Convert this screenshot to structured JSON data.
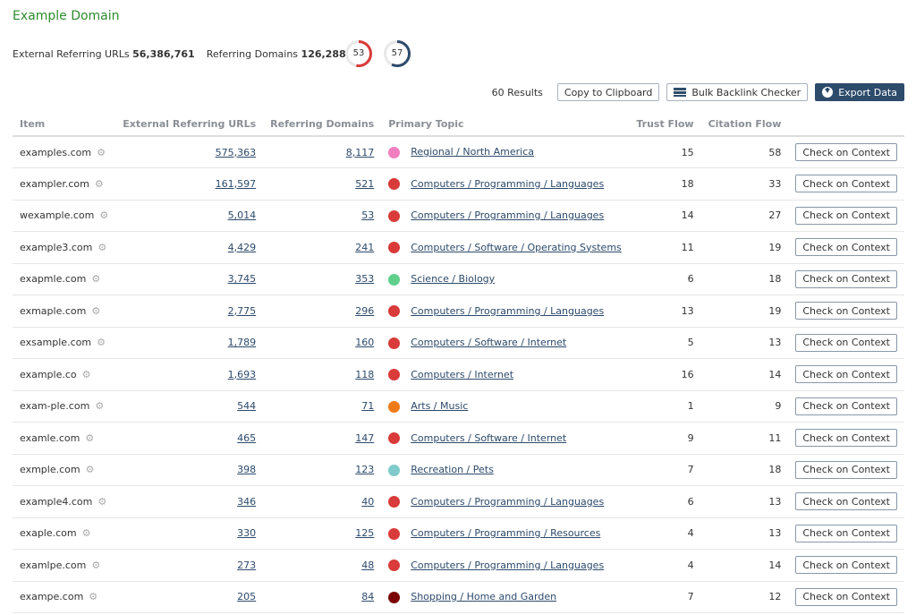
{
  "header": {
    "title": "Example Domain",
    "external_label": "External Referring URLs",
    "external_value": "56,386,761",
    "domains_label": "Referring Domains",
    "domains_value": "126,288"
  },
  "gauges": [
    {
      "value": "53",
      "level": 0.53,
      "color": "#d93a3a"
    },
    {
      "value": "57",
      "level": 0.57,
      "color": "#2d4b6b"
    }
  ],
  "toolbar": {
    "results": "60 Results",
    "copy_label": "Copy to Clipboard",
    "bulk_label": "Bulk Backlink Checker",
    "export_label": "Export Data"
  },
  "columns": {
    "item": "Item",
    "ext_urls": "External Referring URLs",
    "ref_domains": "Referring Domains",
    "topic": "Primary Topic",
    "trust": "Trust Flow",
    "citation": "Citation Flow"
  },
  "rows": [
    {
      "item": "examples.com",
      "ext": "575,363",
      "dom": "8,117",
      "topic": "Regional / North America",
      "color": "#f07fbf",
      "tf": "15",
      "cf": "58",
      "action": "Check on Context"
    },
    {
      "item": "exampler.com",
      "ext": "161,597",
      "dom": "521",
      "topic": "Computers / Programming / Languages",
      "color": "#d93a3a",
      "tf": "18",
      "cf": "33",
      "action": "Check on Context"
    },
    {
      "item": "wexample.com",
      "ext": "5,014",
      "dom": "53",
      "topic": "Computers / Programming / Languages",
      "color": "#d93a3a",
      "tf": "14",
      "cf": "27",
      "action": "Check on Context"
    },
    {
      "item": "example3.com",
      "ext": "4,429",
      "dom": "241",
      "topic": "Computers / Software / Operating Systems",
      "color": "#d93a3a",
      "tf": "11",
      "cf": "19",
      "action": "Check on Context"
    },
    {
      "item": "exapmle.com",
      "ext": "3,745",
      "dom": "353",
      "topic": "Science / Biology",
      "color": "#5fcf8a",
      "tf": "6",
      "cf": "18",
      "action": "Check on Context"
    },
    {
      "item": "exmaple.com",
      "ext": "2,775",
      "dom": "296",
      "topic": "Computers / Programming / Languages",
      "color": "#d93a3a",
      "tf": "13",
      "cf": "19",
      "action": "Check on Context"
    },
    {
      "item": "exsample.com",
      "ext": "1,789",
      "dom": "160",
      "topic": "Computers / Software / Internet",
      "color": "#d93a3a",
      "tf": "5",
      "cf": "13",
      "action": "Check on Context"
    },
    {
      "item": "example.co",
      "ext": "1,693",
      "dom": "118",
      "topic": "Computers / Internet",
      "color": "#d93a3a",
      "tf": "16",
      "cf": "14",
      "action": "Check on Context"
    },
    {
      "item": "exam-ple.com",
      "ext": "544",
      "dom": "71",
      "topic": "Arts / Music",
      "color": "#f07a1a",
      "tf": "1",
      "cf": "9",
      "action": "Check on Context"
    },
    {
      "item": "examle.com",
      "ext": "465",
      "dom": "147",
      "topic": "Computers / Software / Internet",
      "color": "#d93a3a",
      "tf": "9",
      "cf": "11",
      "action": "Check on Context"
    },
    {
      "item": "exmple.com",
      "ext": "398",
      "dom": "123",
      "topic": "Recreation / Pets",
      "color": "#7fcaca",
      "tf": "7",
      "cf": "18",
      "action": "Check on Context"
    },
    {
      "item": "example4.com",
      "ext": "346",
      "dom": "40",
      "topic": "Computers / Programming / Languages",
      "color": "#d93a3a",
      "tf": "6",
      "cf": "13",
      "action": "Check on Context"
    },
    {
      "item": "exaple.com",
      "ext": "330",
      "dom": "125",
      "topic": "Computers / Programming / Resources",
      "color": "#d93a3a",
      "tf": "4",
      "cf": "13",
      "action": "Check on Context"
    },
    {
      "item": "examlpe.com",
      "ext": "273",
      "dom": "48",
      "topic": "Computers / Programming / Languages",
      "color": "#d93a3a",
      "tf": "4",
      "cf": "14",
      "action": "Check on Context"
    },
    {
      "item": "exampe.com",
      "ext": "205",
      "dom": "84",
      "topic": "Shopping / Home and Garden",
      "color": "#7a0000",
      "tf": "7",
      "cf": "12",
      "action": "Check on Context"
    }
  ]
}
